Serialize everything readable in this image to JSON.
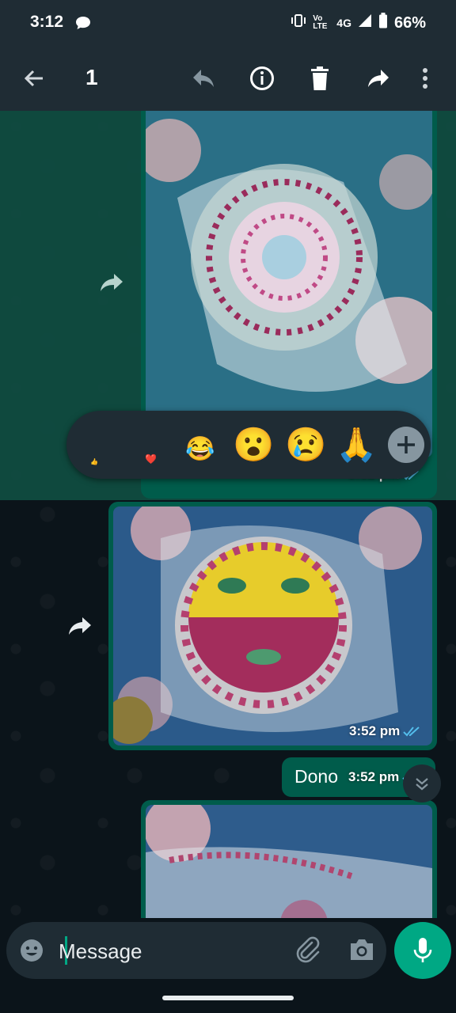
{
  "status_bar": {
    "time": "3:12",
    "network_label": "4G",
    "volte_label": "Vo LTE",
    "battery": "66%"
  },
  "app_bar": {
    "selected_count": "1",
    "icons": [
      "back-arrow-icon",
      "reply-icon",
      "info-icon",
      "delete-icon",
      "forward-icon",
      "more-vert-icon"
    ]
  },
  "messages": [
    {
      "type": "image",
      "time": "3:52 pm",
      "status": "read"
    },
    {
      "type": "image",
      "time": "3:52 pm",
      "status": "read"
    },
    {
      "type": "text",
      "text": "Dono",
      "time": "3:52 pm",
      "status": "read"
    },
    {
      "type": "image"
    }
  ],
  "reactions": [
    "👍",
    "❤️",
    "😂",
    "😮",
    "😢",
    "🙏"
  ],
  "composer": {
    "placeholder": "Message"
  },
  "colors": {
    "accent": "#00a884",
    "bubble_out": "#005c4b",
    "background": "#0b141a",
    "bar": "#1f2c34",
    "read_tick": "#53bdeb"
  }
}
